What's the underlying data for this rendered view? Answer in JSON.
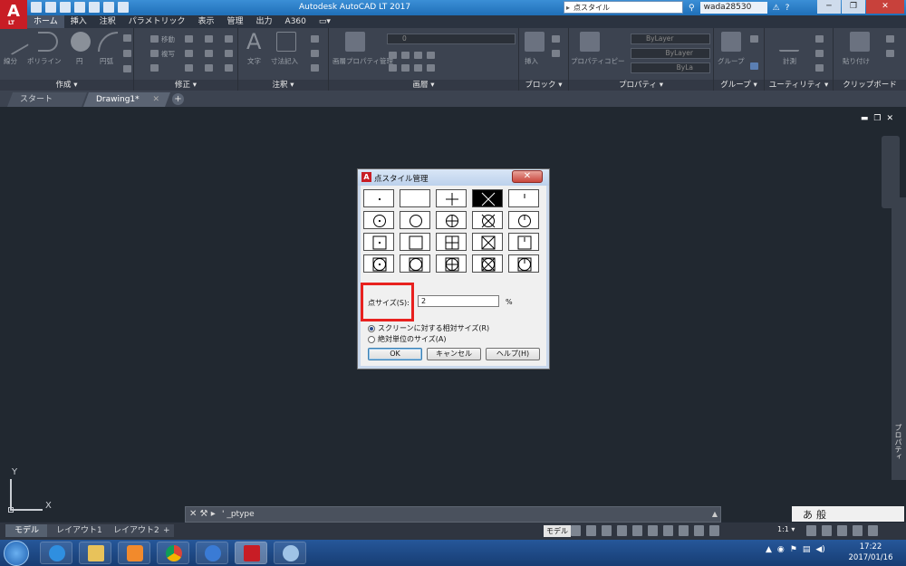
{
  "window": {
    "title": "Autodesk AutoCAD LT 2017",
    "app_logo": "A",
    "app_logo_sub": "LT",
    "search_text": "点スタイル",
    "user": "wada28530"
  },
  "ribbon_tabs": [
    "ホーム",
    "挿入",
    "注釈",
    "パラメトリック",
    "表示",
    "管理",
    "出力",
    "A360"
  ],
  "ribbon_panels": {
    "create": "作成 ▾",
    "modify": "修正 ▾",
    "annotate": "注釈 ▾",
    "layers": "画層 ▾",
    "block": "ブロック ▾",
    "properties": "プロパティ ▾",
    "group": "グループ ▾",
    "utility": "ユーティリティ ▾",
    "clipboard": "クリップボード"
  },
  "ribbon_labels": {
    "line": "線分",
    "polyline": "ポリライン",
    "circle": "円",
    "arc": "円弧",
    "text": "文字",
    "dimension": "寸法記入",
    "layer_props": "画層プロパティ管理",
    "insert": "挿入",
    "match_props": "プロパティコピー",
    "group": "グループ",
    "measure": "計測",
    "paste": "貼り付け",
    "move": "移動",
    "copy": "複写",
    "layer_value": "0",
    "bylayer": "ByLayer",
    "bylayer2": "ByLayer",
    "bylayer3": "ByLa"
  },
  "file_tabs": {
    "start": "スタート",
    "drawing": "Drawing1*"
  },
  "ucs": {
    "x": "X",
    "y": "Y"
  },
  "side_panel_label": "プロパティ",
  "command_line": {
    "text": "' _ptype"
  },
  "ime": {
    "mode1": "あ",
    "mode2": "般"
  },
  "layout_tabs": [
    "モデル",
    "レイアウト1",
    "レイアウト2"
  ],
  "status": {
    "model": "モデル",
    "scale": "1:1 ▾"
  },
  "clock": {
    "time": "17:22",
    "date": "2017/01/16"
  },
  "dialog": {
    "title": "点スタイル管理",
    "size_label": "点サイズ(S):",
    "size_value": "2",
    "size_unit": "%",
    "radio_relative": "スクリーンに対する相対サイズ(R)",
    "radio_absolute": "絶対単位のサイズ(A)",
    "selected_radio": "relative",
    "ok": "OK",
    "cancel": "キャンセル",
    "help": "ヘルプ(H)",
    "selected_style": 3
  },
  "colors": {
    "accent_red": "#e8211f",
    "autocad_red": "#c81d25",
    "canvas": "#212830"
  }
}
